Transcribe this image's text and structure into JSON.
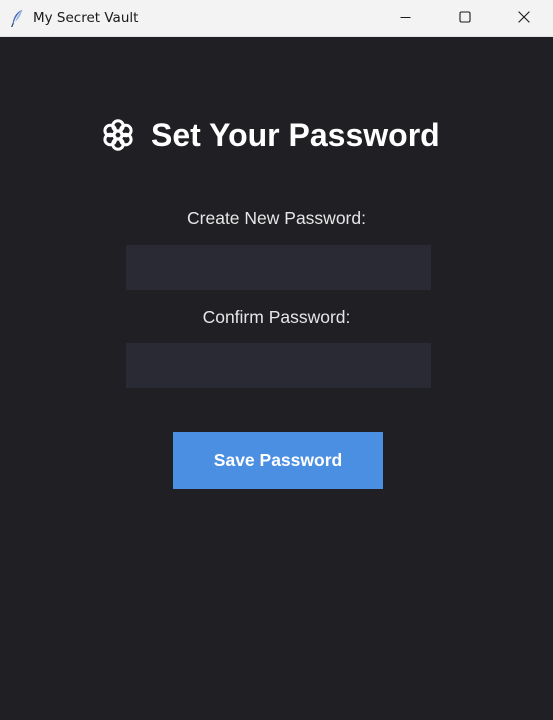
{
  "window": {
    "title": "My Secret Vault",
    "controls": {
      "minimize": "minimize",
      "maximize": "maximize",
      "close": "close"
    }
  },
  "heading": {
    "icon": "gear-icon",
    "text": "Set Your Password"
  },
  "form": {
    "new_password_label": "Create New Password:",
    "new_password_value": "",
    "confirm_password_label": "Confirm Password:",
    "confirm_password_value": "",
    "save_label": "Save Password"
  },
  "colors": {
    "background": "#1f1f24",
    "input_background": "#2a2a34",
    "button_accent": "#4a8fe2",
    "titlebar": "#f3f3f3"
  }
}
